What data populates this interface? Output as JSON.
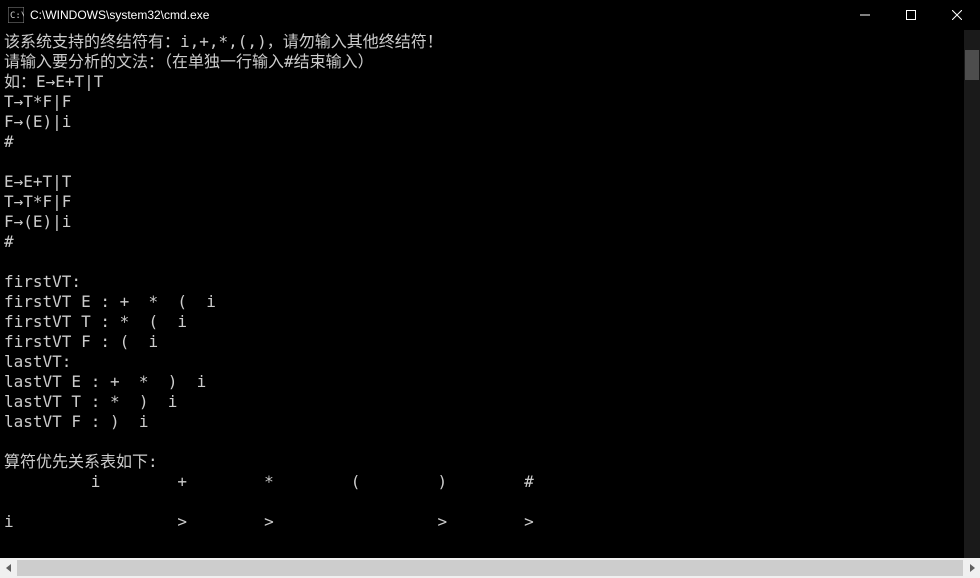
{
  "window": {
    "title": "C:\\WINDOWS\\system32\\cmd.exe"
  },
  "console": {
    "lines": {
      "l0": "该系统支持的终结符有：i,+,*,(,)，请勿输入其他终结符！",
      "l1": "请输入要分析的文法：（在单独一行输入#结束输入）",
      "l2": "如：E→E+T|T",
      "l3": "T→T*F|F",
      "l4": "F→(E)|i",
      "l5": "#",
      "l6": "",
      "l7": "E→E+T|T",
      "l8": "T→T*F|F",
      "l9": "F→(E)|i",
      "l10": "#",
      "l11": "",
      "l12": "firstVT:",
      "l13": "firstVT E : +  *  (  i",
      "l14": "firstVT T : *  (  i",
      "l15": "firstVT F : (  i",
      "l16": "lastVT:",
      "l17": "lastVT E : +  *  )  i",
      "l18": "lastVT T : *  )  i",
      "l19": "lastVT F : )  i",
      "l20": "",
      "l21": "算符优先关系表如下:",
      "l22": "         i        +        *        (        )        #",
      "l23": "",
      "l24": "i                 >        >                 >        >"
    }
  }
}
